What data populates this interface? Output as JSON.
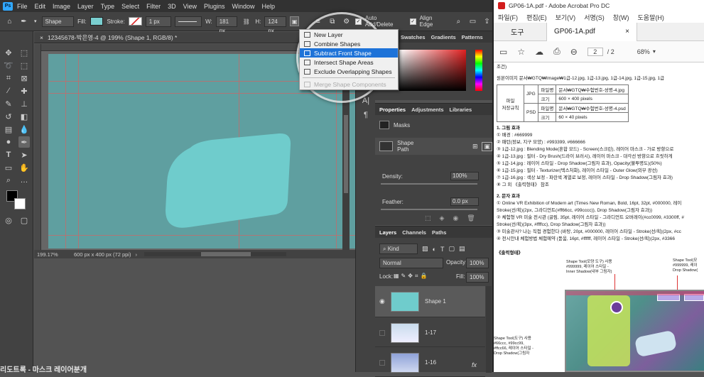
{
  "photoshop": {
    "menu": [
      "File",
      "Edit",
      "Image",
      "Layer",
      "Type",
      "Select",
      "Filter",
      "3D",
      "View",
      "Plugins",
      "Window",
      "Help"
    ],
    "options": {
      "mode": "Shape",
      "fill_label": "Fill:",
      "stroke_label": "Stroke:",
      "stroke_width": "1 px",
      "w_label": "W:",
      "w_value": "181 px",
      "h_label": "H:",
      "h_value": "124 px",
      "auto_add_delete": "Auto Add/Delete",
      "align_edge": "Align Edge"
    },
    "document_tab": "12345678-박은영-4 @ 199% (Shape 1, RGB/8) *",
    "zoom": "199.17%",
    "doc_size": "600 px x 400 px (72 ppi)",
    "shape_menu": {
      "items": [
        {
          "label": "New Layer",
          "state": "normal"
        },
        {
          "label": "Combine Shapes",
          "state": "normal"
        },
        {
          "label": "Subtract Front Shape",
          "state": "selected"
        },
        {
          "label": "Intersect Shape Areas",
          "state": "normal"
        },
        {
          "label": "Exclude Overlapping Shapes",
          "state": "normal"
        },
        {
          "label": "Merge Shape Components",
          "state": "disabled"
        }
      ]
    },
    "color_panel_tabs": [
      "Swatches",
      "Gradients",
      "Patterns"
    ],
    "properties": {
      "tabs": [
        "Properties",
        "Adjustments",
        "Libraries"
      ],
      "masks_label": "Masks",
      "shape_path_label": "Shape Path",
      "density_label": "Density:",
      "density_value": "100%",
      "feather_label": "Feather:",
      "feather_value": "0.0 px"
    },
    "layers": {
      "tabs": [
        "Layers",
        "Channels",
        "Paths"
      ],
      "kind": "Kind",
      "blend_mode": "Normal",
      "opacity_label": "Opacity:",
      "opacity_value": "100%",
      "lock_label": "Lock:",
      "fill_label": "Fill:",
      "fill_value": "100%",
      "items": [
        {
          "name": "Shape 1"
        },
        {
          "name": "1-17"
        },
        {
          "name": "1-16"
        }
      ]
    },
    "colors": {
      "canvas": "#5f9fa0",
      "shape": "#6fcccc",
      "guide": "#c46a6a"
    },
    "bottom_caption": "리도트록 - 마스크 레이어분개"
  },
  "acrobat": {
    "title": "GP06-1A.pdf - Adobe Acrobat Pro DC",
    "menu": [
      "파일(F)",
      "편집(E)",
      "보기(V)",
      "서명(S)",
      "창(W)",
      "도움말(H)"
    ],
    "tools_tab": "도구",
    "doc_tab": "GP06-1A.pdf",
    "page_current": "2",
    "page_total": "/ 2",
    "zoom": "68%",
    "content": {
      "heading": "조건)",
      "row1": "원본이미지   문서₩GTQ₩Image₩1급-12.jpg, 1급-13.jpg, 1급-14.jpg, 1급-15.jpg, 1급",
      "table": [
        [
          "파일",
          "JPG",
          "파일명",
          "문서₩GTQ₩수험번호-성명-4.jpg"
        ],
        [
          "저장규칙",
          "",
          "크기",
          "600 × 400 pixels"
        ],
        [
          "",
          "PSD",
          "파일명",
          "문서₩GTQ₩수험번호-성명-4.psd"
        ],
        [
          "",
          "",
          "크기",
          "60 × 40 pixels"
        ]
      ],
      "section1": "1. 그림 효과",
      "lines1": [
        "① 배경 : #669999",
        "② 패턴(정보, 지구 모양) : #993399, #666666",
        "③ 1급-12.jpg : Blending Mode(혼합 모드) - Screen(스크린), 레이어 마스크 - 가로 방향으로",
        "④ 1급-13.jpg : 필터 - Dry Brush(드라이 브러시), 레이어 마스크 - 대각선 방향으로 흐릿하게",
        "⑤ 1급-14.jpg : 레이어 스타일 - Drop Shadow(그림자 효과), Opacity(불투명도)(50%)",
        "⑥ 1급-15.jpg : 필터 - Texturizer(텍스처화), 레이어 스타일 - Outer Glow(외부 광선)",
        "⑦ 1급-16.jpg : 색상 보정 - 파란색 계열로 보정, 레이어 스타일 - Drop Shadow(그림자 효과)",
        "⑧ 그 외 《출력형태》 참조"
      ],
      "section2": "2. 문자 효과",
      "lines2": [
        "① Online VR Exhibition of Modern art (Times New Roman, Bold, 16pt, 32pt, #000000, 레이",
        "   Stroke(선/획)(2px, 그라디언트(#ff66cc, #99cccc)), Drop Shadow(그림자 효과))",
        "② 체험형 VR 미술 전시관 (굴림, 35pt, 레이어 스타일 - 그라디언트 오버레이(#cc0099, #3300ff, #",
        "   Stroke(선/획)(3px, #ffffcc), Drop Shadow(그림자 효과))",
        "③ 미술관사? 나는 직접 경험한다 (바탕, 20pt, #000000, 레이어 스타일 - Stroke(선/획)(2px, #cc",
        "④ 전시안내 체험방법 체험예약 (돋움, 16pt, #ffffff, 레이어 스타일 - Stroke(선/획)(2px, #3366"
      ],
      "section3": "《출력형태》",
      "callout1": "Shape Tool(모양 도구) 사용\n#999999, 레이어 스타일 -\nInner Shadow(내부 그림자)",
      "callout2": "Shape Tool(모\n#999999, 레이\nDrop Shadow(",
      "callout3": "Shape Tool(도구) 사용\n#66ccc, #99cc99,\n#ffcc66, 레이어 스타일 -\nDrop Shadow(그림자"
    }
  }
}
